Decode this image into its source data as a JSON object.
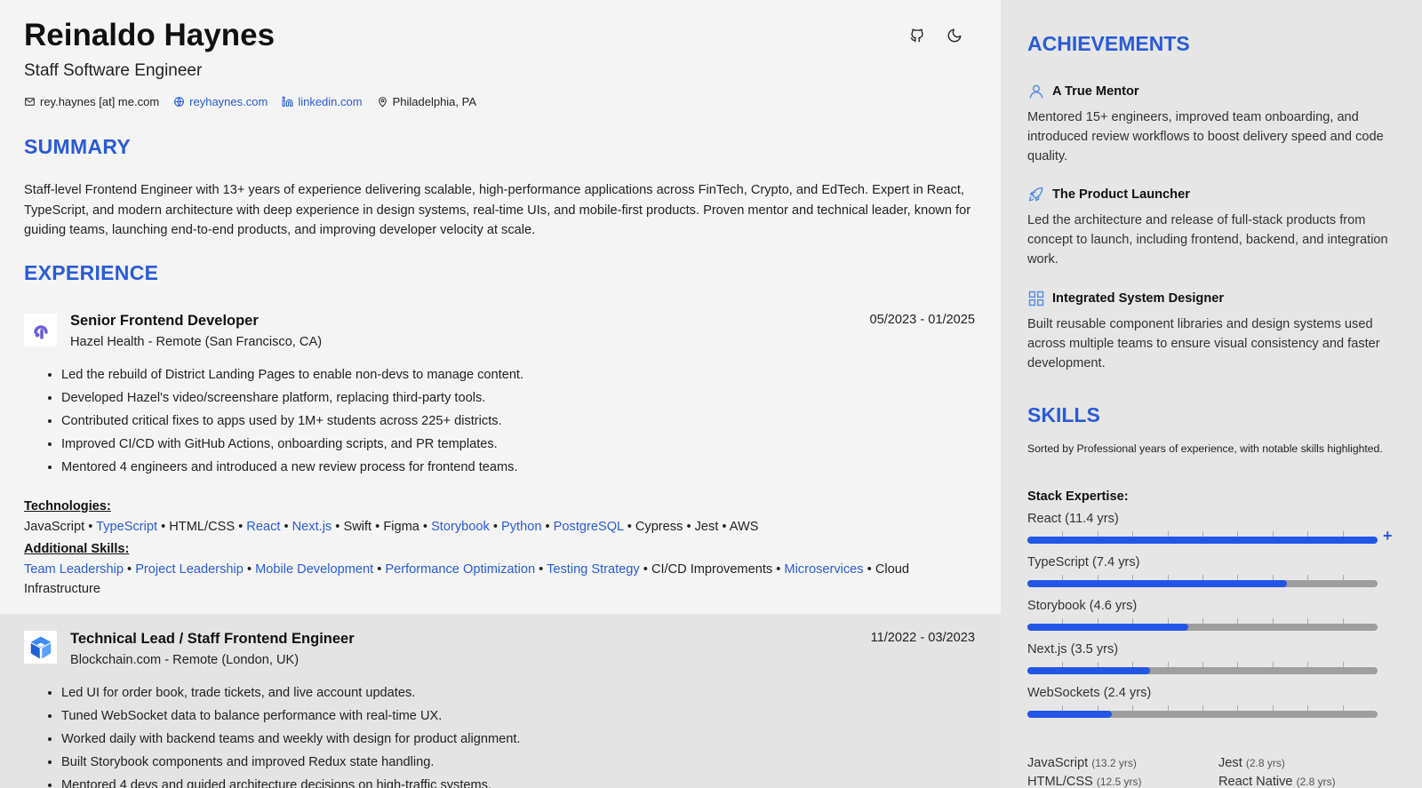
{
  "header": {
    "name": "Reinaldo Haynes",
    "role": "Staff Software Engineer",
    "icons": [
      "github-icon",
      "moon-icon"
    ]
  },
  "contacts": {
    "email": "rey.haynes [at] me.com",
    "website": "reyhaynes.com",
    "linkedin": "linkedin.com",
    "location": "Philadelphia, PA"
  },
  "summary": {
    "heading": "SUMMARY",
    "text": "Staff-level Frontend Engineer with 13+ years of experience delivering scalable, high-performance applications across FinTech, Crypto, and EdTech. Expert in React, TypeScript, and modern architecture with deep experience in design systems, real-time UIs, and mobile-first products. Proven mentor and technical leader, known for guiding teams, launching end-to-end products, and improving developer velocity at scale."
  },
  "experience": {
    "heading": "EXPERIENCE",
    "jobs": [
      {
        "title": "Senior Frontend Developer",
        "company": "Hazel Health - Remote (San Francisco, CA)",
        "dates": "05/2023 - 01/2025",
        "bullets": [
          "Led the rebuild of District Landing Pages to enable non-devs to manage content.",
          "Developed Hazel's video/screenshare platform, replacing third-party tools.",
          "Contributed critical fixes to apps used by 1M+ students across 225+ districts.",
          "Improved CI/CD with GitHub Actions, onboarding scripts, and PR templates.",
          "Mentored 4 engineers and introduced a new review process for frontend teams."
        ],
        "technologies_label": "Technologies:",
        "technologies": [
          {
            "t": "JavaScript",
            "hl": false
          },
          {
            "t": "TypeScript",
            "hl": true
          },
          {
            "t": "HTML/CSS",
            "hl": false
          },
          {
            "t": "React",
            "hl": true
          },
          {
            "t": "Next.js",
            "hl": true
          },
          {
            "t": "Swift",
            "hl": false
          },
          {
            "t": "Figma",
            "hl": false
          },
          {
            "t": "Storybook",
            "hl": true
          },
          {
            "t": "Python",
            "hl": true
          },
          {
            "t": "PostgreSQL",
            "hl": true
          },
          {
            "t": "Cypress",
            "hl": false
          },
          {
            "t": "Jest",
            "hl": false
          },
          {
            "t": "AWS",
            "hl": false
          }
        ],
        "skills_label": "Additional Skills:",
        "skills": [
          {
            "t": "Team Leadership",
            "hl": true
          },
          {
            "t": "Project Leadership",
            "hl": true
          },
          {
            "t": "Mobile Development",
            "hl": true
          },
          {
            "t": "Performance Optimization",
            "hl": true
          },
          {
            "t": "Testing Strategy",
            "hl": true
          },
          {
            "t": "CI/CD Improvements",
            "hl": false
          },
          {
            "t": "Microservices",
            "hl": true
          },
          {
            "t": "Cloud Infrastructure",
            "hl": false
          }
        ]
      },
      {
        "title": "Technical Lead / Staff Frontend Engineer",
        "company": "Blockchain.com - Remote (London, UK)",
        "dates": "11/2022 - 03/2023",
        "bullets": [
          "Led UI for order book, trade tickets, and live account updates.",
          "Tuned WebSocket data to balance performance with real-time UX.",
          "Worked daily with backend teams and weekly with design for product alignment.",
          "Built Storybook components and improved Redux state handling.",
          "Mentored 4 devs and guided architecture decisions on high-traffic systems."
        ]
      }
    ]
  },
  "achievements": {
    "heading": "ACHIEVEMENTS",
    "items": [
      {
        "icon": "user-icon",
        "title": "A True Mentor",
        "desc": "Mentored 15+ engineers, improved team onboarding, and introduced review workflows to boost delivery speed and code quality."
      },
      {
        "icon": "rocket-icon",
        "title": "The Product Launcher",
        "desc": "Led the architecture and release of full-stack products from concept to launch, including frontend, backend, and integration work."
      },
      {
        "icon": "grid-icon",
        "title": "Integrated System Designer",
        "desc": "Built reusable component libraries and design systems used across multiple teams to ensure visual consistency and faster development."
      }
    ]
  },
  "skills": {
    "heading": "SKILLS",
    "note": "Sorted by Professional years of experience, with notable skills highlighted.",
    "stack_heading": "Stack Expertise:",
    "stack": [
      {
        "label": "React (11.4 yrs)",
        "level": 1.0,
        "expandable": true
      },
      {
        "label": "TypeScript (7.4 yrs)",
        "level": 0.74,
        "expandable": false
      },
      {
        "label": "Storybook (4.6 yrs)",
        "level": 0.46,
        "expandable": false
      },
      {
        "label": "Next.js (3.5 yrs)",
        "level": 0.35,
        "expandable": false
      },
      {
        "label": "WebSockets (2.4 yrs)",
        "level": 0.24,
        "expandable": false
      }
    ],
    "other": [
      {
        "name": "JavaScript",
        "years": "(13.2 yrs)"
      },
      {
        "name": "Jest",
        "years": "(2.8 yrs)"
      },
      {
        "name": "HTML/CSS",
        "years": "(12.5 yrs)"
      },
      {
        "name": "React Native",
        "years": "(2.8 yrs)"
      }
    ]
  },
  "colors": {
    "accent": "#2a5bd7",
    "bar_fill": "#2356e6",
    "bar_track": "#9e9e9e"
  }
}
